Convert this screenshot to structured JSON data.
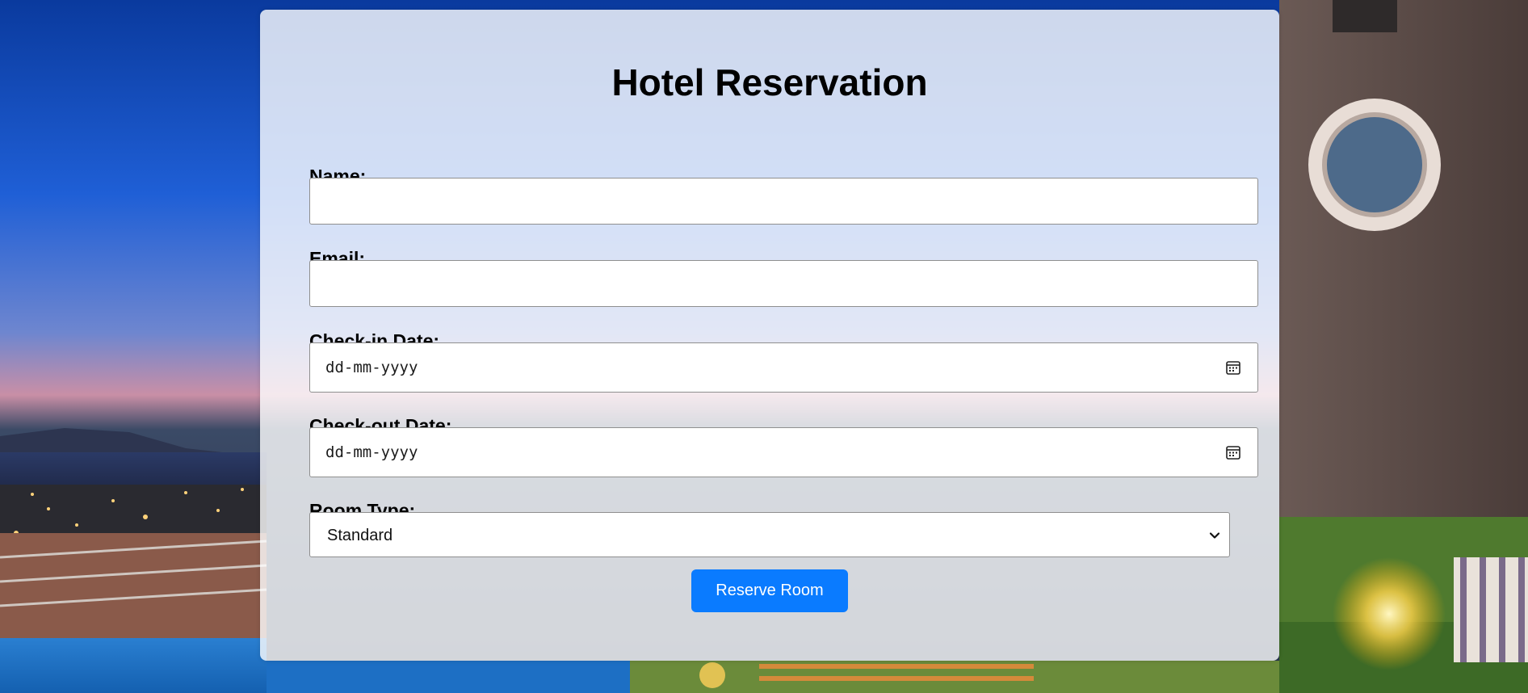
{
  "page": {
    "title": "Hotel Reservation"
  },
  "form": {
    "name": {
      "label": "Name:",
      "value": ""
    },
    "email": {
      "label": "Email:",
      "value": ""
    },
    "check_in": {
      "label": "Check-in Date:",
      "placeholder": "dd-mm-yyyy"
    },
    "check_out": {
      "label": "Check-out Date:",
      "placeholder": "dd-mm-yyyy"
    },
    "room_type": {
      "label": "Room Type:",
      "selected": "Standard"
    },
    "submit_label": "Reserve Room"
  },
  "colors": {
    "button_background": "#0a7bff",
    "button_text": "#ffffff",
    "card_background": "rgba(255,255,255,0.80)"
  },
  "icons": {
    "date_picker": "calendar-icon",
    "select_arrow": "chevron-down-icon"
  }
}
